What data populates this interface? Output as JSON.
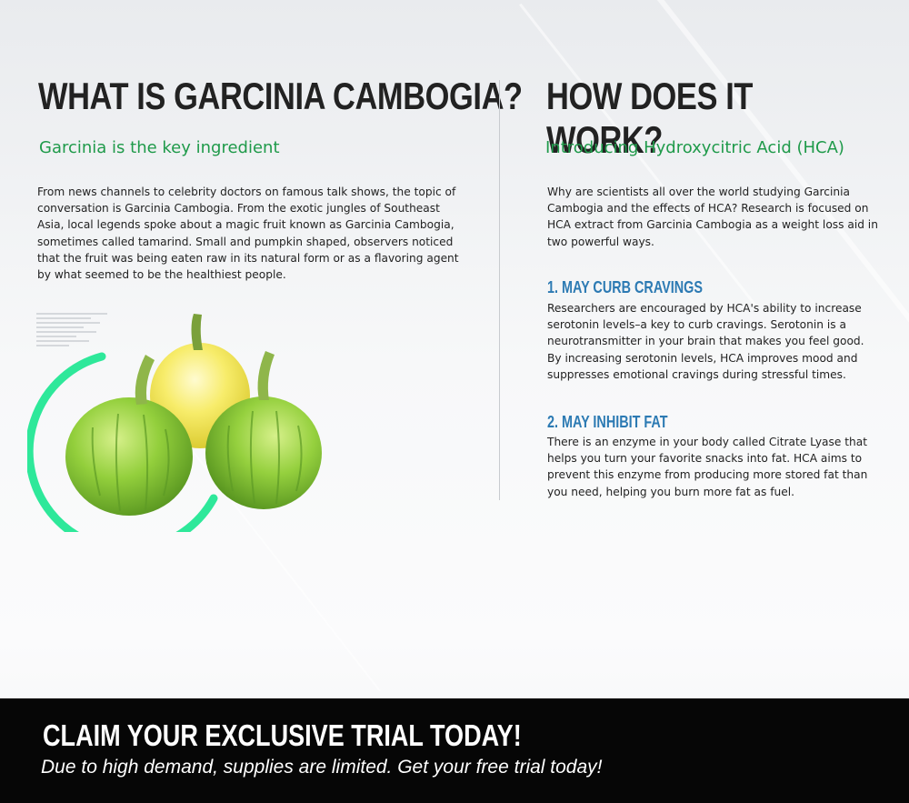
{
  "left": {
    "title": "WHAT IS GARCINIA CAMBOGIA?",
    "subtitle": "Garcinia is the key ingredient",
    "body": [
      "From news channels to celebrity doctors on famous talk shows, the topic of",
      "conversation is Garcinia Cambogia.  From the exotic jungles of Southeast",
      "Asia, local legends spoke about a magic fruit known as Garcinia Cambogia,",
      "sometimes called tamarind.  Small and pumpkin shaped, observers noticed",
      "that the fruit was being eaten raw in its natural form or as a flavoring agent",
      "by what seemed to be the healthiest people."
    ],
    "image": {
      "name": "garcinia-fruit-image",
      "accent_color": "#2ee89a"
    }
  },
  "right": {
    "title": "HOW DOES IT WORK?",
    "subtitle": "Introducing Hydroxycitric Acid (HCA)",
    "intro": [
      "Why are scientists all over the world studying Garcinia",
      "Cambogia and the effects of HCA? Research is focused on",
      "HCA extract from Garcinia Cambogia as a weight loss aid in",
      "two powerful ways."
    ],
    "points": [
      {
        "heading": "1. MAY CURB CRAVINGS",
        "lines": [
          "Researchers are encouraged by HCA's ability to increase",
          "serotonin levels–a key to curb cravings. Serotonin is a",
          "neurotransmitter in your brain that makes you feel good.",
          "By increasing serotonin levels, HCA improves mood and",
          "suppresses emotional cravings during stressful times."
        ]
      },
      {
        "heading": "2. MAY INHIBIT FAT",
        "lines": [
          "There is an enzyme in your body called Citrate Lyase that",
          "helps you turn your favorite snacks into fat. HCA aims to",
          "prevent this enzyme from producing more stored fat than",
          "you need, helping you burn more fat as fuel."
        ]
      }
    ]
  },
  "footer": {
    "title": "CLAIM YOUR EXCLUSIVE TRIAL TODAY!",
    "subtitle": "Due to high demand, supplies are limited. Get your free trial today!"
  },
  "colors": {
    "subtitle_green": "#1f9a4a",
    "heading_blue": "#2c7ab3",
    "ring_green": "#2ee89a",
    "footer_bg": "#060606"
  }
}
